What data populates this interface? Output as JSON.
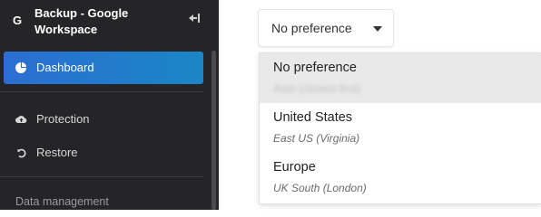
{
  "sidebar": {
    "brand_title": "Backup - Google\nWorkspace",
    "brand_logo": "G",
    "collapse_icon": "collapse-left-icon",
    "items": [
      {
        "label": "Dashboard",
        "icon": "pie-chart-icon",
        "active": true
      },
      {
        "label": "Protection",
        "icon": "cloud-upload-icon",
        "active": false
      },
      {
        "label": "Restore",
        "icon": "restore-icon",
        "active": false
      }
    ],
    "section_title": "Data management"
  },
  "region_select": {
    "selected_label": "No preference",
    "options": [
      {
        "label": "No preference",
        "sub": "Auto (closest first)",
        "selected": true
      },
      {
        "label": "United States",
        "sub": "East US (Virginia)",
        "selected": false
      },
      {
        "label": "Europe",
        "sub": "UK South (London)",
        "selected": false
      }
    ]
  },
  "colors": {
    "sidebar_bg": "#252528",
    "active_start": "#2b6ed2",
    "active_end": "#1a86c6",
    "selected_option_bg": "#e9e9e9"
  }
}
